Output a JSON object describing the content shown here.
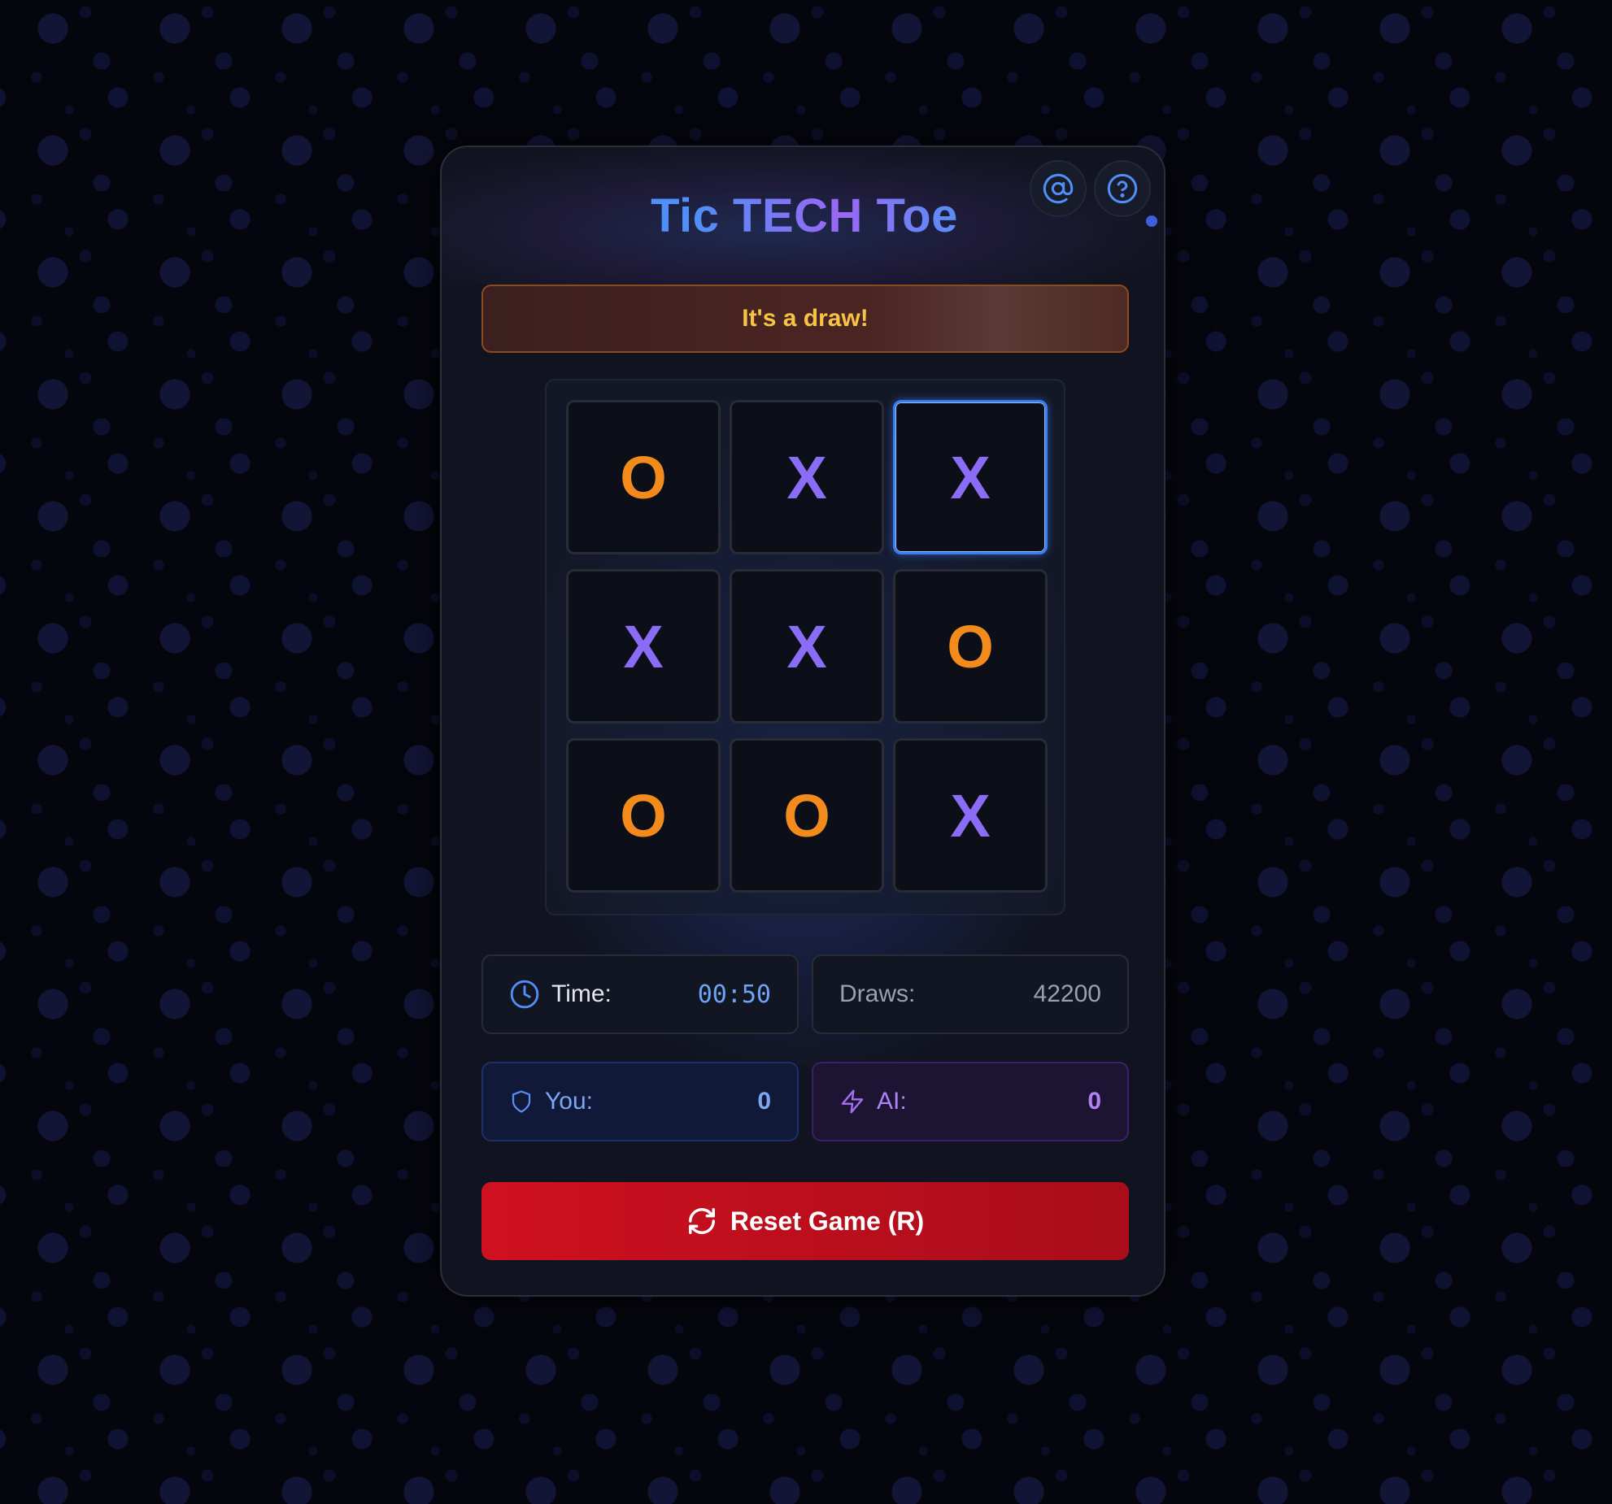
{
  "app": {
    "title": "Tic TECH Toe"
  },
  "header": {
    "contact_icon": "at-sign-icon",
    "help_icon": "question-circle-icon"
  },
  "status": {
    "message": "It's a draw!"
  },
  "board": {
    "cells": [
      "O",
      "X",
      "X",
      "X",
      "X",
      "O",
      "O",
      "O",
      "X"
    ],
    "highlighted_cell_index": 2
  },
  "stats": {
    "time_label": "Time:",
    "time_value": "00:50",
    "draws_label": "Draws:",
    "draws_value": "42200",
    "you_label": "You:",
    "you_value": "0",
    "ai_label": "AI:",
    "ai_value": "0"
  },
  "actions": {
    "reset_label": "Reset Game (R)"
  },
  "colors": {
    "x_mark": "#8a6cf6",
    "o_mark": "#f38a1c",
    "banner_text": "#f6c344",
    "reset_button": "#cf1020"
  }
}
